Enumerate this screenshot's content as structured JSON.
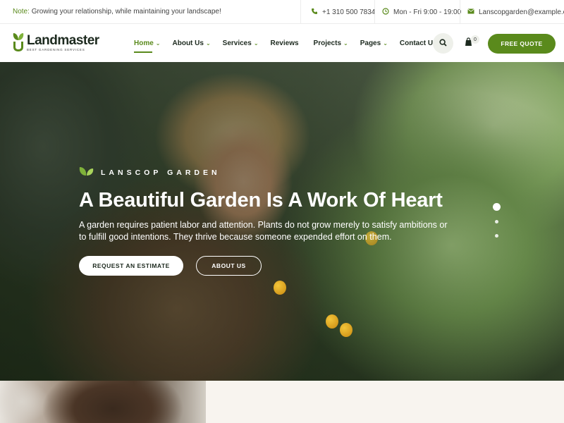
{
  "topbar": {
    "note_label": "Note:",
    "note_text": "Growing your relationship, while maintaining your landscape!",
    "phone": "+1 310 500 7834",
    "hours": "Mon - Fri 9:00 - 19:00",
    "email": "Lanscopgarden@example.com"
  },
  "brand": {
    "name": "Landmaster",
    "tagline": "BEST GARDENING SERVICES",
    "accent_color": "#5a8a1c"
  },
  "nav": {
    "items": [
      {
        "label": "Home",
        "dropdown": true,
        "active": true
      },
      {
        "label": "About Us",
        "dropdown": true
      },
      {
        "label": "Services",
        "dropdown": true
      },
      {
        "label": "Reviews",
        "dropdown": false
      },
      {
        "label": "Projects",
        "dropdown": true
      },
      {
        "label": "Pages",
        "dropdown": true
      },
      {
        "label": "Contact Us",
        "dropdown": false
      }
    ],
    "cart_count": "0",
    "quote_label": "FREE QUOTE"
  },
  "hero": {
    "eyebrow": "LANSCOP GARDEN",
    "title": "A Beautiful Garden Is A Work Of Heart",
    "description": "A garden requires patient labor and attention. Plants do not grow merely to satisfy ambitions or to fulfill good intentions. They thrive because someone expended effort on them.",
    "primary_button": "REQUEST AN ESTIMATE",
    "secondary_button": "ABOUT US",
    "slide_count": 3,
    "active_slide": 1
  },
  "icons": {
    "phone": "phone-icon",
    "clock": "clock-icon",
    "email": "email-icon",
    "search": "search-icon",
    "cart": "cart-icon",
    "leaf": "leaf-icon"
  }
}
